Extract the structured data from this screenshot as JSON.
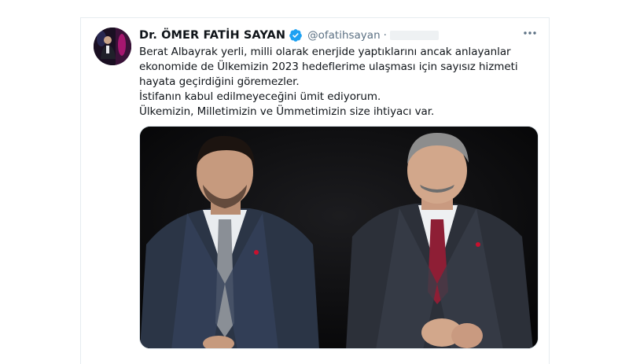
{
  "tweet": {
    "author": {
      "display_name": "Dr. ÖMER FATİH SAYAN",
      "handle": "@ofatihsayan",
      "verified": true,
      "separator": "·"
    },
    "text_lines": [
      "Berat Albayrak yerli, milli olarak enerjide yaptıklarını ancak anlayanlar",
      "ekonomide de Ülkemizin 2023 hedeflerime ulaşması için sayısız hizmeti",
      "hayata geçirdiğini göremezler.",
      "İstifanın kabul edilmeyeceğini ümit ediyorum.",
      "Ülkemizin, Milletimizin ve Ümmetimizin size ihtiyacı var."
    ],
    "icons": {
      "verified": "verified-badge-icon",
      "more": "more-options-icon"
    }
  },
  "colors": {
    "name": "#0f1419",
    "secondary": "#5b7083",
    "verified_blue": "#1da1f2",
    "border": "#e6ecf0"
  }
}
